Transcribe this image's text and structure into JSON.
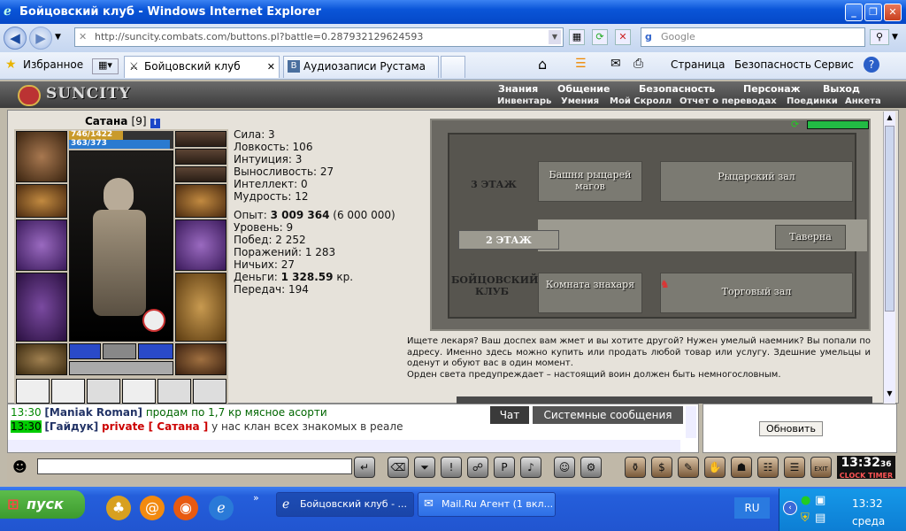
{
  "window": {
    "title": "Бойцовский клуб - Windows Internet Explorer"
  },
  "nav": {
    "url": "http://suncity.combats.com/buttons.pl?battle=0.287932129624593",
    "search_placeholder": "Google"
  },
  "favbar": {
    "favorites_label": "Избранное",
    "tabs": [
      {
        "label": "Бойцовский клуб"
      },
      {
        "label": "Аудиозаписи Рустама Саип..."
      }
    ],
    "tools": {
      "page": "Страница",
      "security": "Безопасность",
      "service": "Сервис"
    }
  },
  "game": {
    "logo": "SUNCITY",
    "menu_top": [
      "Знания",
      "Общение",
      "Безопасность",
      "Персонаж",
      "Выход"
    ],
    "menu_bottom": [
      "Инвентарь",
      "Умения",
      "Мой Скролл",
      "Отчет о переводах",
      "Поединки",
      "Анкета"
    ],
    "character": {
      "name": "Сатана",
      "level": "[9]",
      "hp": "746/1422",
      "mana": "363/373",
      "hp_fraction": 0.52,
      "mana_fraction": 0.97
    },
    "stats": [
      "Сила: 3",
      "Ловкость: 106",
      "Интуиция: 3",
      "Выносливость: 27",
      "Интеллект: 0",
      "Мудрость: 12"
    ],
    "experience": {
      "label": "Опыт:",
      "value": "3 009 364",
      "next": "(6 000 000)"
    },
    "stats2": [
      "Уровень: 9",
      "Побед: 2 252",
      "Поражений: 1 283",
      "Ничьих: 27"
    ],
    "money": {
      "label": "Деньги:",
      "value": "1 328.59",
      "unit": "кр."
    },
    "transfers": "Передач: 194",
    "map": {
      "floors": [
        "3 ЭТАЖ",
        "2 ЭТАЖ",
        "БОЙЦОВСКИЙ КЛУБ"
      ],
      "rooms": [
        "Башня рыцарей магов",
        "Рыцарский зал",
        "Таверна",
        "Комната знахаря",
        "Торговый зал"
      ]
    },
    "description": "Ищете лекаря? Ваш доспех вам жмет и вы хотите другой? Нужен умелый наемник? Вы попали по адресу. Именно здесь можно купить или продать любой товар или услугу. Здешние умельцы и оденут и обуют вас в один момент.",
    "description2": "Орден света предупреждает – настоящий воин должен быть немногословным."
  },
  "chat": {
    "tabs": [
      "Чат",
      "Системные сообщения"
    ],
    "lines": [
      {
        "time": "13:30",
        "nick": "[Maniak Roman]",
        "text": "продам по 1,7 кр мясное асорти"
      },
      {
        "time": "13:30",
        "nick": "[Гайдук]",
        "private": "private [ Сатана ]",
        "text": "у нас клан всех знакомых в реале"
      }
    ],
    "refresh_label": "Обновить",
    "clock": "13:32",
    "clock_sec": "36",
    "clock_label": "CLOCK",
    "timer_label": "TIMER",
    "exit_label": "EXIT"
  },
  "taskbar": {
    "start": "пуск",
    "tasks": [
      "Бойцовский клуб - ...",
      "Mail.Ru Агент (1 вкл..."
    ],
    "lang": "RU",
    "time": "13:32",
    "day": "среда"
  }
}
